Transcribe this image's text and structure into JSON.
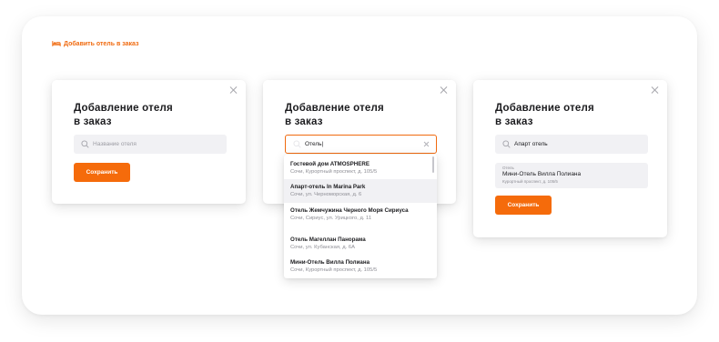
{
  "add_hotel_link": {
    "label": "Добавить отель в заказ",
    "icon": "bed-icon",
    "color": "#f06a0f"
  },
  "accent_color": "#f56b0b",
  "modal_empty": {
    "title_line1": "Добавление отеля",
    "title_line2": "в заказ",
    "search": {
      "value": "",
      "placeholder": "Название отеля"
    },
    "save_label": "Сохранить"
  },
  "modal_typing": {
    "title_line1": "Добавление отеля",
    "title_line2": "в заказ",
    "search": {
      "value": "Отель|",
      "placeholder": "Название отеля"
    },
    "suggestions": [
      {
        "name": "Гостевой дом ATMOSPHERE",
        "address": "Сочи, Курортный проспект, д. 105/5"
      },
      {
        "name": "Апарт-отель In Marina Park",
        "address": "Сочи, ул. Черноморская, д. 6"
      },
      {
        "name": "Отель Жемчужина Черного Моря Сириуса",
        "address": "Сочи, Сириус, ул. Урицкого, д. 11"
      },
      {
        "name": "Отель Магеллан Панорама",
        "address": "Сочи, ул. Кубанская, д. 6А"
      },
      {
        "name": "Мини-Отель Вилла Полиана",
        "address": "Сочи, Курортный проспект, д. 105/5"
      }
    ]
  },
  "modal_selected": {
    "title_line1": "Добавление отеля",
    "title_line2": "в заказ",
    "search": {
      "value": "Апарт отель",
      "placeholder": "Название отеля"
    },
    "selected": {
      "caption": "Отель",
      "name": "Мини-Отель Вилла Полиана",
      "address": "Курортный проспект, д. 105/5"
    },
    "save_label": "Сохранить"
  }
}
